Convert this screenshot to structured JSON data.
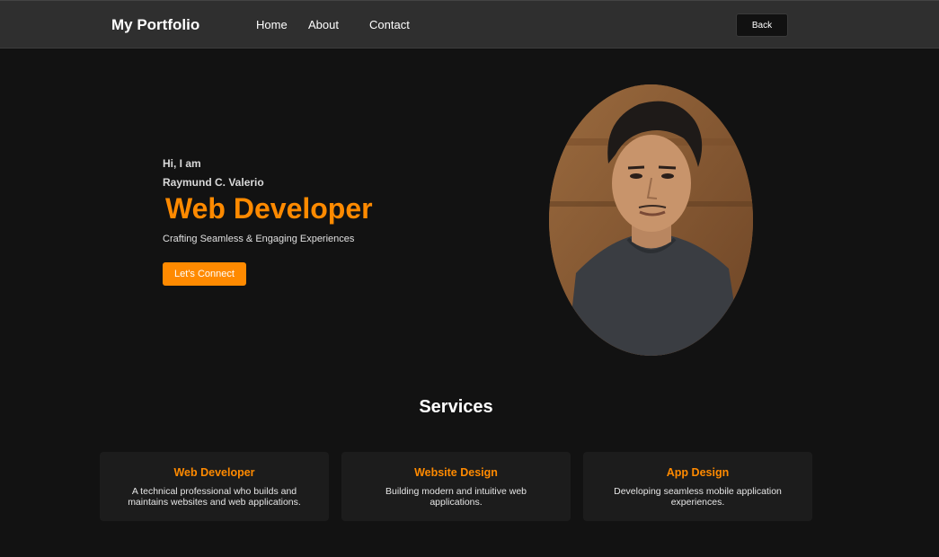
{
  "header": {
    "brand": "My Portfolio",
    "nav": [
      "Home",
      "About",
      "Contact"
    ],
    "back_label": "Back"
  },
  "hero": {
    "greeting": "Hi, I am",
    "name": "Raymund C. Valerio",
    "role": "Web Developer",
    "tagline": "Crafting Seamless & Engaging Experiences",
    "cta_label": "Let's Connect",
    "portrait": "profile-photo"
  },
  "services": {
    "title": "Services",
    "items": [
      {
        "title": "Web Developer",
        "desc": "A technical professional who builds and maintains websites and web applications."
      },
      {
        "title": "Website Design",
        "desc": "Building modern and intuitive web applications."
      },
      {
        "title": "App Design",
        "desc": "Developing seamless mobile application experiences."
      }
    ]
  },
  "colors": {
    "accent": "#ff8a00",
    "header_bg": "#2f2f2f",
    "page_bg": "#121212",
    "card_bg": "#1c1c1c"
  }
}
